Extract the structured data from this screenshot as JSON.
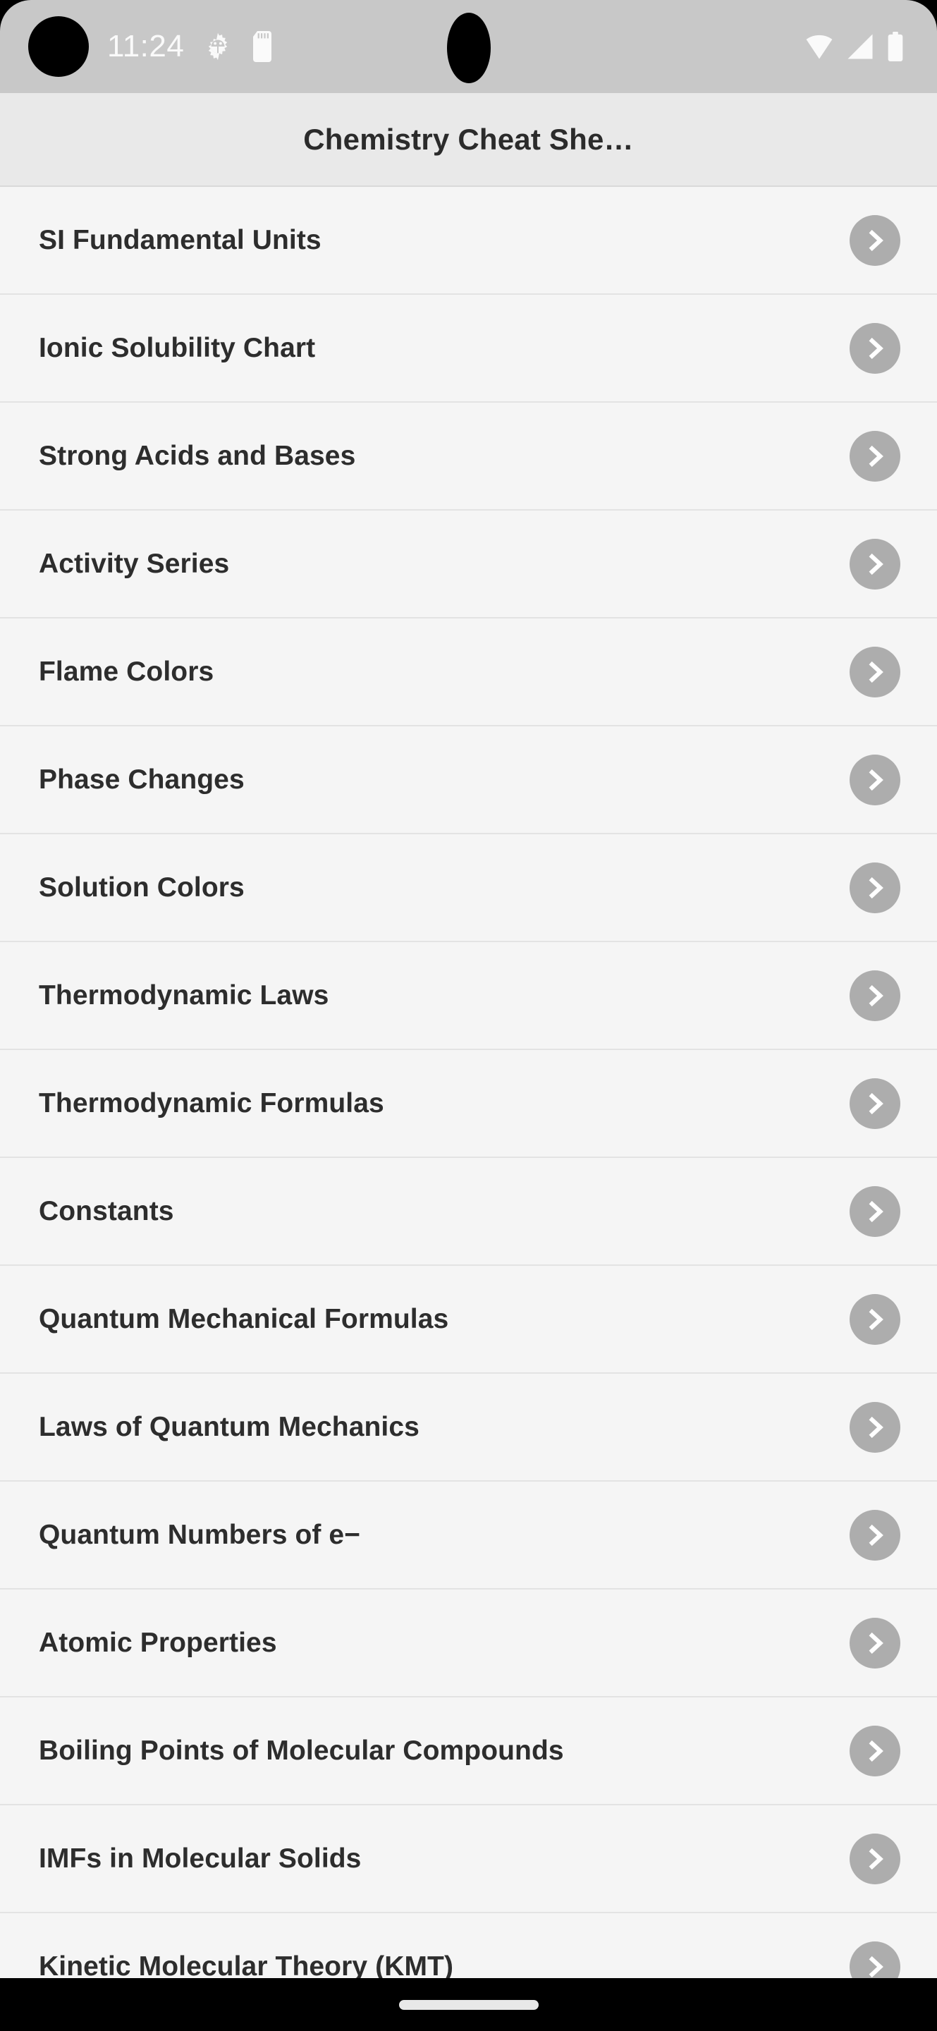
{
  "status_bar": {
    "time": "11:24",
    "icons_left": [
      "gear-icon",
      "sd-card-icon"
    ],
    "icons_right": [
      "wifi-icon",
      "cellular-signal-icon",
      "battery-icon"
    ],
    "background_color": "#c8c8c8",
    "foreground_color": "#fafafa"
  },
  "app_bar": {
    "title": "Chemistry Cheat She…",
    "background_color": "#e9e9e9",
    "text_color": "#2b2b2b"
  },
  "list": {
    "chevron_icon": "chevron-right-icon",
    "chevron_circle_color": "#adadad",
    "chevron_glyph_color": "#ffffff",
    "row_background_color": "#f5f5f5",
    "divider_color": "#e3e3e3",
    "items": [
      {
        "label": "SI Fundamental Units"
      },
      {
        "label": "Ionic Solubility Chart"
      },
      {
        "label": "Strong Acids and Bases"
      },
      {
        "label": "Activity Series"
      },
      {
        "label": "Flame Colors"
      },
      {
        "label": "Phase Changes"
      },
      {
        "label": "Solution Colors"
      },
      {
        "label": "Thermodynamic Laws"
      },
      {
        "label": "Thermodynamic Formulas"
      },
      {
        "label": "Constants"
      },
      {
        "label": "Quantum Mechanical Formulas"
      },
      {
        "label": "Laws of Quantum Mechanics"
      },
      {
        "label": "Quantum Numbers of e−"
      },
      {
        "label": "Atomic Properties"
      },
      {
        "label": "Boiling Points of Molecular Compounds"
      },
      {
        "label": "IMFs in Molecular Solids"
      },
      {
        "label": "Kinetic Molecular Theory (KMT)"
      }
    ]
  },
  "nav_bar": {
    "gesture_pill": "home-gesture-pill",
    "background_color": "#000000"
  }
}
